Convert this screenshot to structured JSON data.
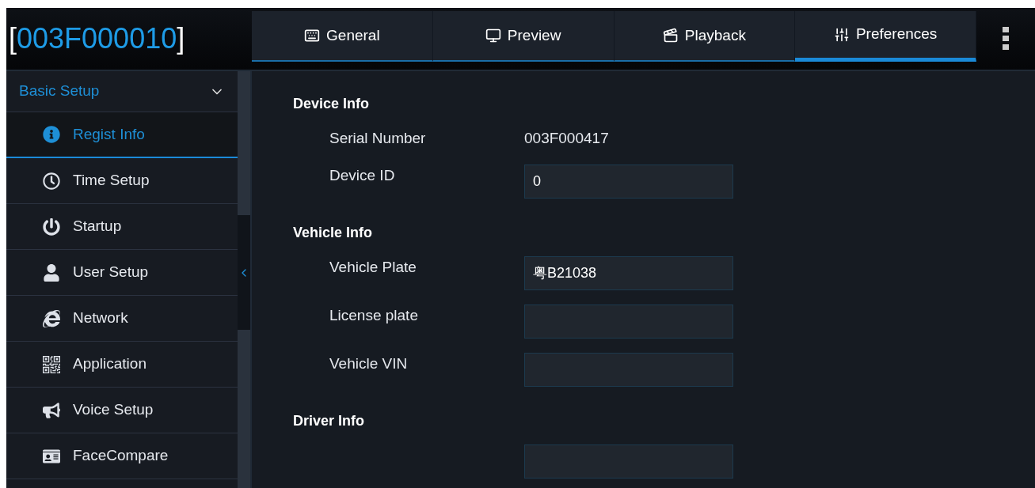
{
  "device_title": {
    "open": "[",
    "id": "003F000010",
    "close": "]"
  },
  "tabs": [
    {
      "label": "General",
      "selected": false
    },
    {
      "label": "Preview",
      "selected": false
    },
    {
      "label": "Playback",
      "selected": false
    },
    {
      "label": "Preferences",
      "selected": true
    }
  ],
  "sidebar": {
    "group": {
      "label": "Basic Setup",
      "expanded": true
    },
    "items": [
      {
        "label": "Regist Info",
        "selected": true
      },
      {
        "label": "Time Setup",
        "selected": false
      },
      {
        "label": "Startup",
        "selected": false
      },
      {
        "label": "User Setup",
        "selected": false
      },
      {
        "label": "Network",
        "selected": false
      },
      {
        "label": "Application",
        "selected": false
      },
      {
        "label": "Voice Setup",
        "selected": false
      },
      {
        "label": "FaceCompare",
        "selected": false
      }
    ]
  },
  "sections": [
    {
      "title": "Device Info",
      "rows": [
        {
          "kind": "text",
          "label": "Serial Number",
          "value": "003F000417"
        },
        {
          "kind": "input",
          "label": "Device ID",
          "value": "0"
        }
      ]
    },
    {
      "title": "Vehicle Info",
      "rows": [
        {
          "kind": "input",
          "label": "Vehicle Plate",
          "value": "粤B21038"
        },
        {
          "kind": "input",
          "label": "License plate"
        },
        {
          "kind": "input",
          "label": "Vehicle VIN"
        }
      ]
    },
    {
      "title": "Driver Info",
      "rows": [
        {
          "kind": "input"
        }
      ]
    }
  ]
}
